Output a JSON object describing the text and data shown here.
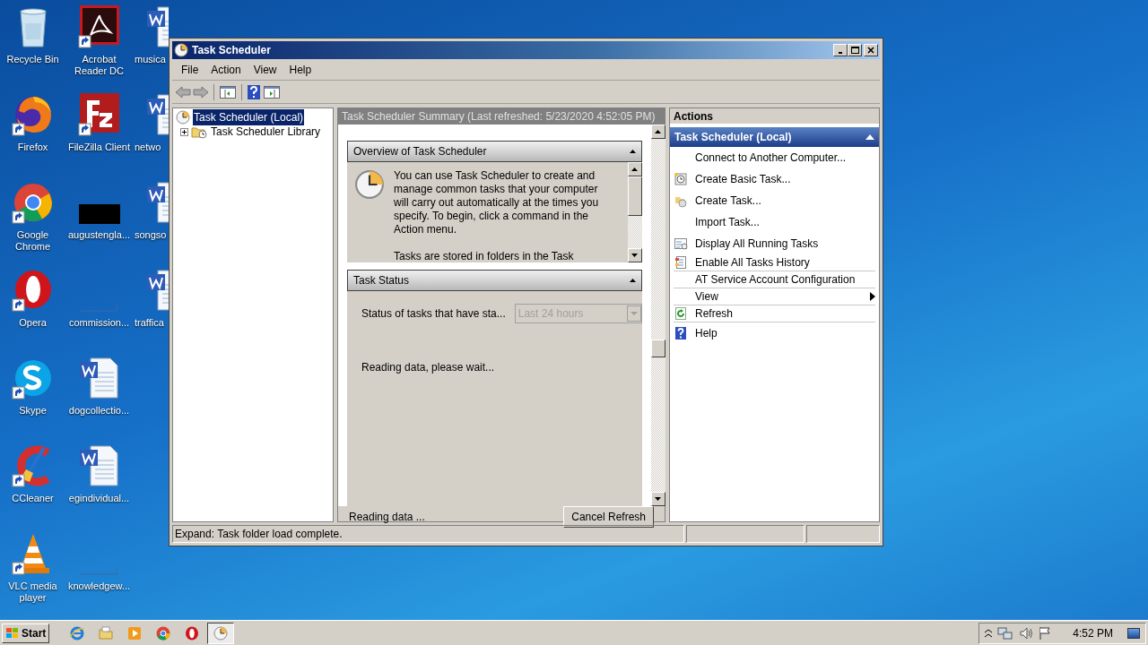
{
  "desktop_columns": [
    [
      {
        "label": "Recycle Bin",
        "kind": "recycle",
        "shortcut": false
      },
      {
        "label": "Firefox",
        "kind": "firefox",
        "shortcut": true
      },
      {
        "label": "Google Chrome",
        "kind": "chrome",
        "shortcut": true
      },
      {
        "label": "Opera",
        "kind": "opera",
        "shortcut": true
      },
      {
        "label": "Skype",
        "kind": "skype",
        "shortcut": true
      },
      {
        "label": "CCleaner",
        "kind": "ccleaner",
        "shortcut": true
      },
      {
        "label": "VLC media player",
        "kind": "vlc",
        "shortcut": true
      }
    ],
    [
      {
        "label": "Acrobat Reader DC",
        "kind": "acrobat",
        "shortcut": true
      },
      {
        "label": "FileZilla Client",
        "kind": "filezilla",
        "shortcut": true
      },
      {
        "label": "augustengla...",
        "kind": "dark",
        "shortcut": false
      },
      {
        "label": "commission...",
        "kind": "blank",
        "shortcut": false
      },
      {
        "label": "dogcollectio...",
        "kind": "word",
        "shortcut": false
      },
      {
        "label": "egindividual...",
        "kind": "word",
        "shortcut": false
      },
      {
        "label": "knowledgew...",
        "kind": "blank",
        "shortcut": false
      }
    ],
    [
      {
        "label": "musica",
        "kind": "word",
        "shortcut": false
      },
      {
        "label": "netwo",
        "kind": "word",
        "shortcut": false
      },
      {
        "label": "songso",
        "kind": "word",
        "shortcut": false
      },
      {
        "label": "traffica",
        "kind": "word",
        "shortcut": false
      }
    ]
  ],
  "window": {
    "title": "Task Scheduler",
    "menu": [
      "File",
      "Action",
      "View",
      "Help"
    ],
    "tree": [
      {
        "label": "Task Scheduler (Local)",
        "selected": true,
        "children": [
          {
            "label": "Task Scheduler Library",
            "selected": false,
            "expanded": false
          }
        ]
      }
    ],
    "summary": {
      "header": "Task Scheduler Summary (Last refreshed: 5/23/2020 4:52:05 PM)",
      "overview": {
        "title": "Overview of Task Scheduler",
        "paragraphs": [
          "You can use Task Scheduler to create and manage common tasks that your computer will carry out automatically at the times you specify. To begin, click a command in the Action menu.",
          "Tasks are stored in folders in the Task"
        ]
      },
      "task_status": {
        "title": "Task Status",
        "label": "Status of tasks that have sta...",
        "dropdown": {
          "value": "Last 24 hours",
          "disabled": true
        },
        "message": "Reading data, please wait..."
      },
      "footer_text": "Reading data ...",
      "button": "Cancel Refresh"
    },
    "actions": {
      "title": "Actions",
      "section": "Task Scheduler (Local)",
      "items": [
        {
          "label": "Connect to Another Computer...",
          "kind": "plain",
          "separator_after": false,
          "submenu": false
        },
        {
          "label": "Create Basic Task...",
          "kind": "basic",
          "separator_after": false,
          "submenu": false
        },
        {
          "label": "Create Task...",
          "kind": "create",
          "separator_after": false,
          "submenu": false
        },
        {
          "label": "Import Task...",
          "kind": "plain",
          "separator_after": false,
          "submenu": false
        },
        {
          "label": "Display All Running Tasks",
          "kind": "running",
          "separator_after": false,
          "submenu": false
        },
        {
          "label": "Enable All Tasks History",
          "kind": "history",
          "separator_after": true,
          "submenu": false
        },
        {
          "label": "AT Service Account Configuration",
          "kind": "plain",
          "separator_after": true,
          "submenu": false
        },
        {
          "label": "View",
          "kind": "plain",
          "separator_after": true,
          "submenu": true
        },
        {
          "label": "Refresh",
          "kind": "refresh",
          "separator_after": true,
          "submenu": false
        },
        {
          "label": "Help",
          "kind": "help",
          "separator_after": false,
          "submenu": false
        }
      ]
    },
    "status_bar": "Expand:  Task folder load complete."
  },
  "taskbar": {
    "start": "Start",
    "apps": [
      {
        "kind": "ie",
        "active": false
      },
      {
        "kind": "explorer",
        "active": false
      },
      {
        "kind": "media",
        "active": false
      },
      {
        "kind": "chrome",
        "active": false
      },
      {
        "kind": "opera",
        "active": false
      },
      {
        "kind": "clock",
        "active": true
      }
    ],
    "time": "4:52 PM"
  }
}
